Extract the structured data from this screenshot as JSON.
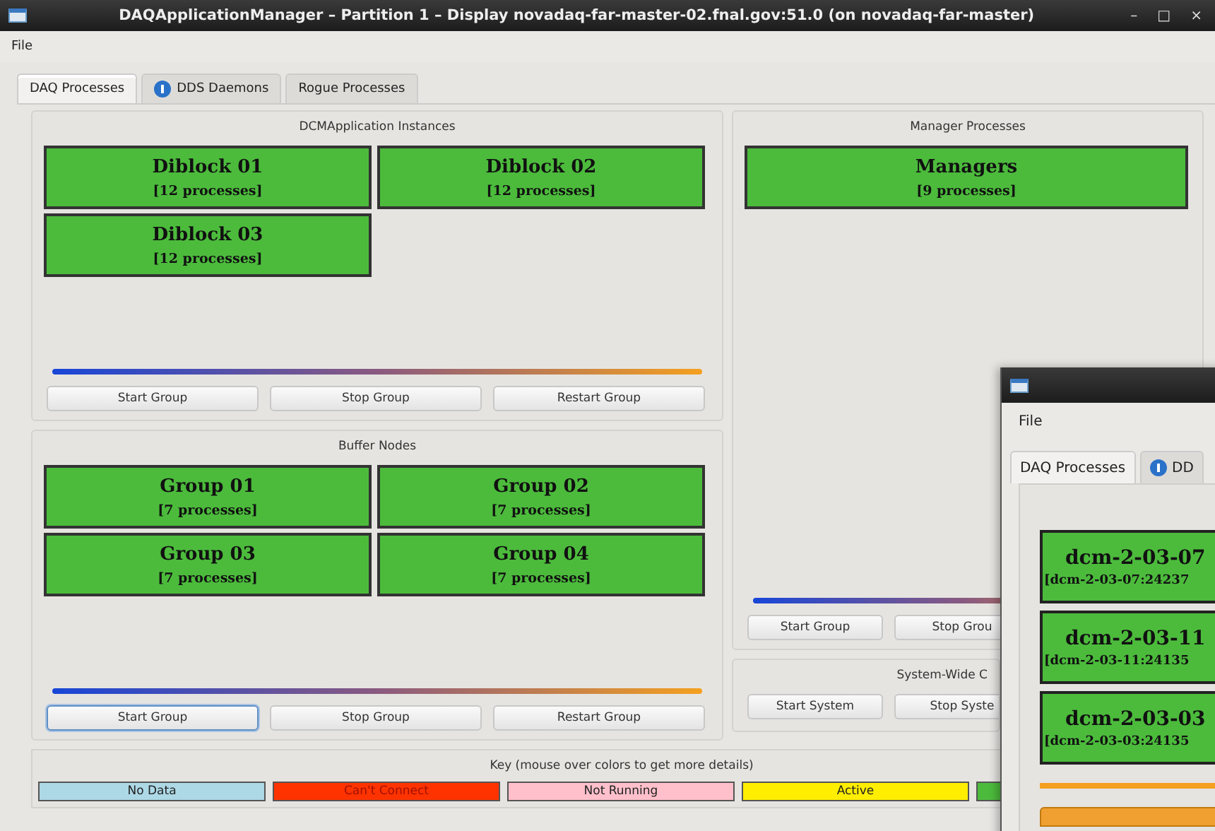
{
  "window": {
    "title": "DAQApplicationManager – Partition 1 – Display novadaq-far-master-02.fnal.gov:51.0 (on novadaq-far-master)",
    "controls": [
      "–",
      "□",
      "×"
    ]
  },
  "menu": [
    "File"
  ],
  "tabs": [
    {
      "label": "DAQ Processes",
      "selected": true,
      "info": false
    },
    {
      "label": "DDS Daemons",
      "selected": false,
      "info": true
    },
    {
      "label": "Rogue Processes",
      "selected": false,
      "info": false
    }
  ],
  "dcm_panel": {
    "title": "DCMApplication Instances",
    "tiles": [
      {
        "name": "Diblock 01",
        "detail": "[12 processes]",
        "color": "#4cbb3c"
      },
      {
        "name": "Diblock 02",
        "detail": "[12 processes]",
        "color": "#4cbb3c"
      },
      {
        "name": "Diblock 03",
        "detail": "[12 processes]",
        "color": "#4cbb3c"
      }
    ],
    "buttons": [
      {
        "label": "Start Group",
        "focused": false
      },
      {
        "label": "Stop Group",
        "focused": false
      },
      {
        "label": "Restart Group",
        "focused": false
      }
    ]
  },
  "buffer_panel": {
    "title": "Buffer Nodes",
    "tiles": [
      {
        "name": "Group 01",
        "detail": "[7 processes]",
        "color": "#4cbb3c"
      },
      {
        "name": "Group 02",
        "detail": "[7 processes]",
        "color": "#4cbb3c"
      },
      {
        "name": "Group 03",
        "detail": "[7 processes]",
        "color": "#4cbb3c"
      },
      {
        "name": "Group 04",
        "detail": "[7 processes]",
        "color": "#4cbb3c"
      }
    ],
    "buttons": [
      {
        "label": "Start Group",
        "focused": true
      },
      {
        "label": "Stop Group",
        "focused": false
      },
      {
        "label": "Restart Group",
        "focused": false
      }
    ]
  },
  "manager_panel": {
    "title": "Manager Processes",
    "tiles": [
      {
        "name": "Managers",
        "detail": "[9 processes]",
        "color": "#4cbb3c"
      }
    ],
    "buttons": [
      {
        "label": "Start Group",
        "focused": false
      },
      {
        "label": "Stop Grou",
        "focused": false
      }
    ]
  },
  "system_panel": {
    "title": "System-Wide C",
    "buttons": [
      {
        "label": "Start System",
        "focused": false
      },
      {
        "label": "Stop Syste",
        "focused": false
      }
    ]
  },
  "key": {
    "title": "Key (mouse over colors to get more details)",
    "items": [
      {
        "label": "No Data",
        "color": "#add8e6"
      },
      {
        "label": "Can't Connect",
        "color": "#ff3300"
      },
      {
        "label": "Not Running",
        "color": "#ffc0cb"
      },
      {
        "label": "Active",
        "color": "#ffee00"
      },
      {
        "color": "#4cbb3c"
      }
    ]
  },
  "overlay_window": {
    "menu": [
      "File"
    ],
    "tabs": [
      {
        "label": "DAQ Processes",
        "selected": true,
        "info": false
      },
      {
        "label": "DD",
        "selected": false,
        "info": true
      }
    ],
    "tiles": [
      {
        "name": "dcm-2-03-07",
        "detail": "[dcm-2-03-07:24237",
        "color": "#4cbb3c"
      },
      {
        "name": "dcm-2-03-11",
        "detail": "[dcm-2-03-11:24135",
        "color": "#4cbb3c"
      },
      {
        "name": "dcm-2-03-03",
        "detail": "[dcm-2-03-03:24135",
        "color": "#4cbb3c"
      }
    ]
  }
}
